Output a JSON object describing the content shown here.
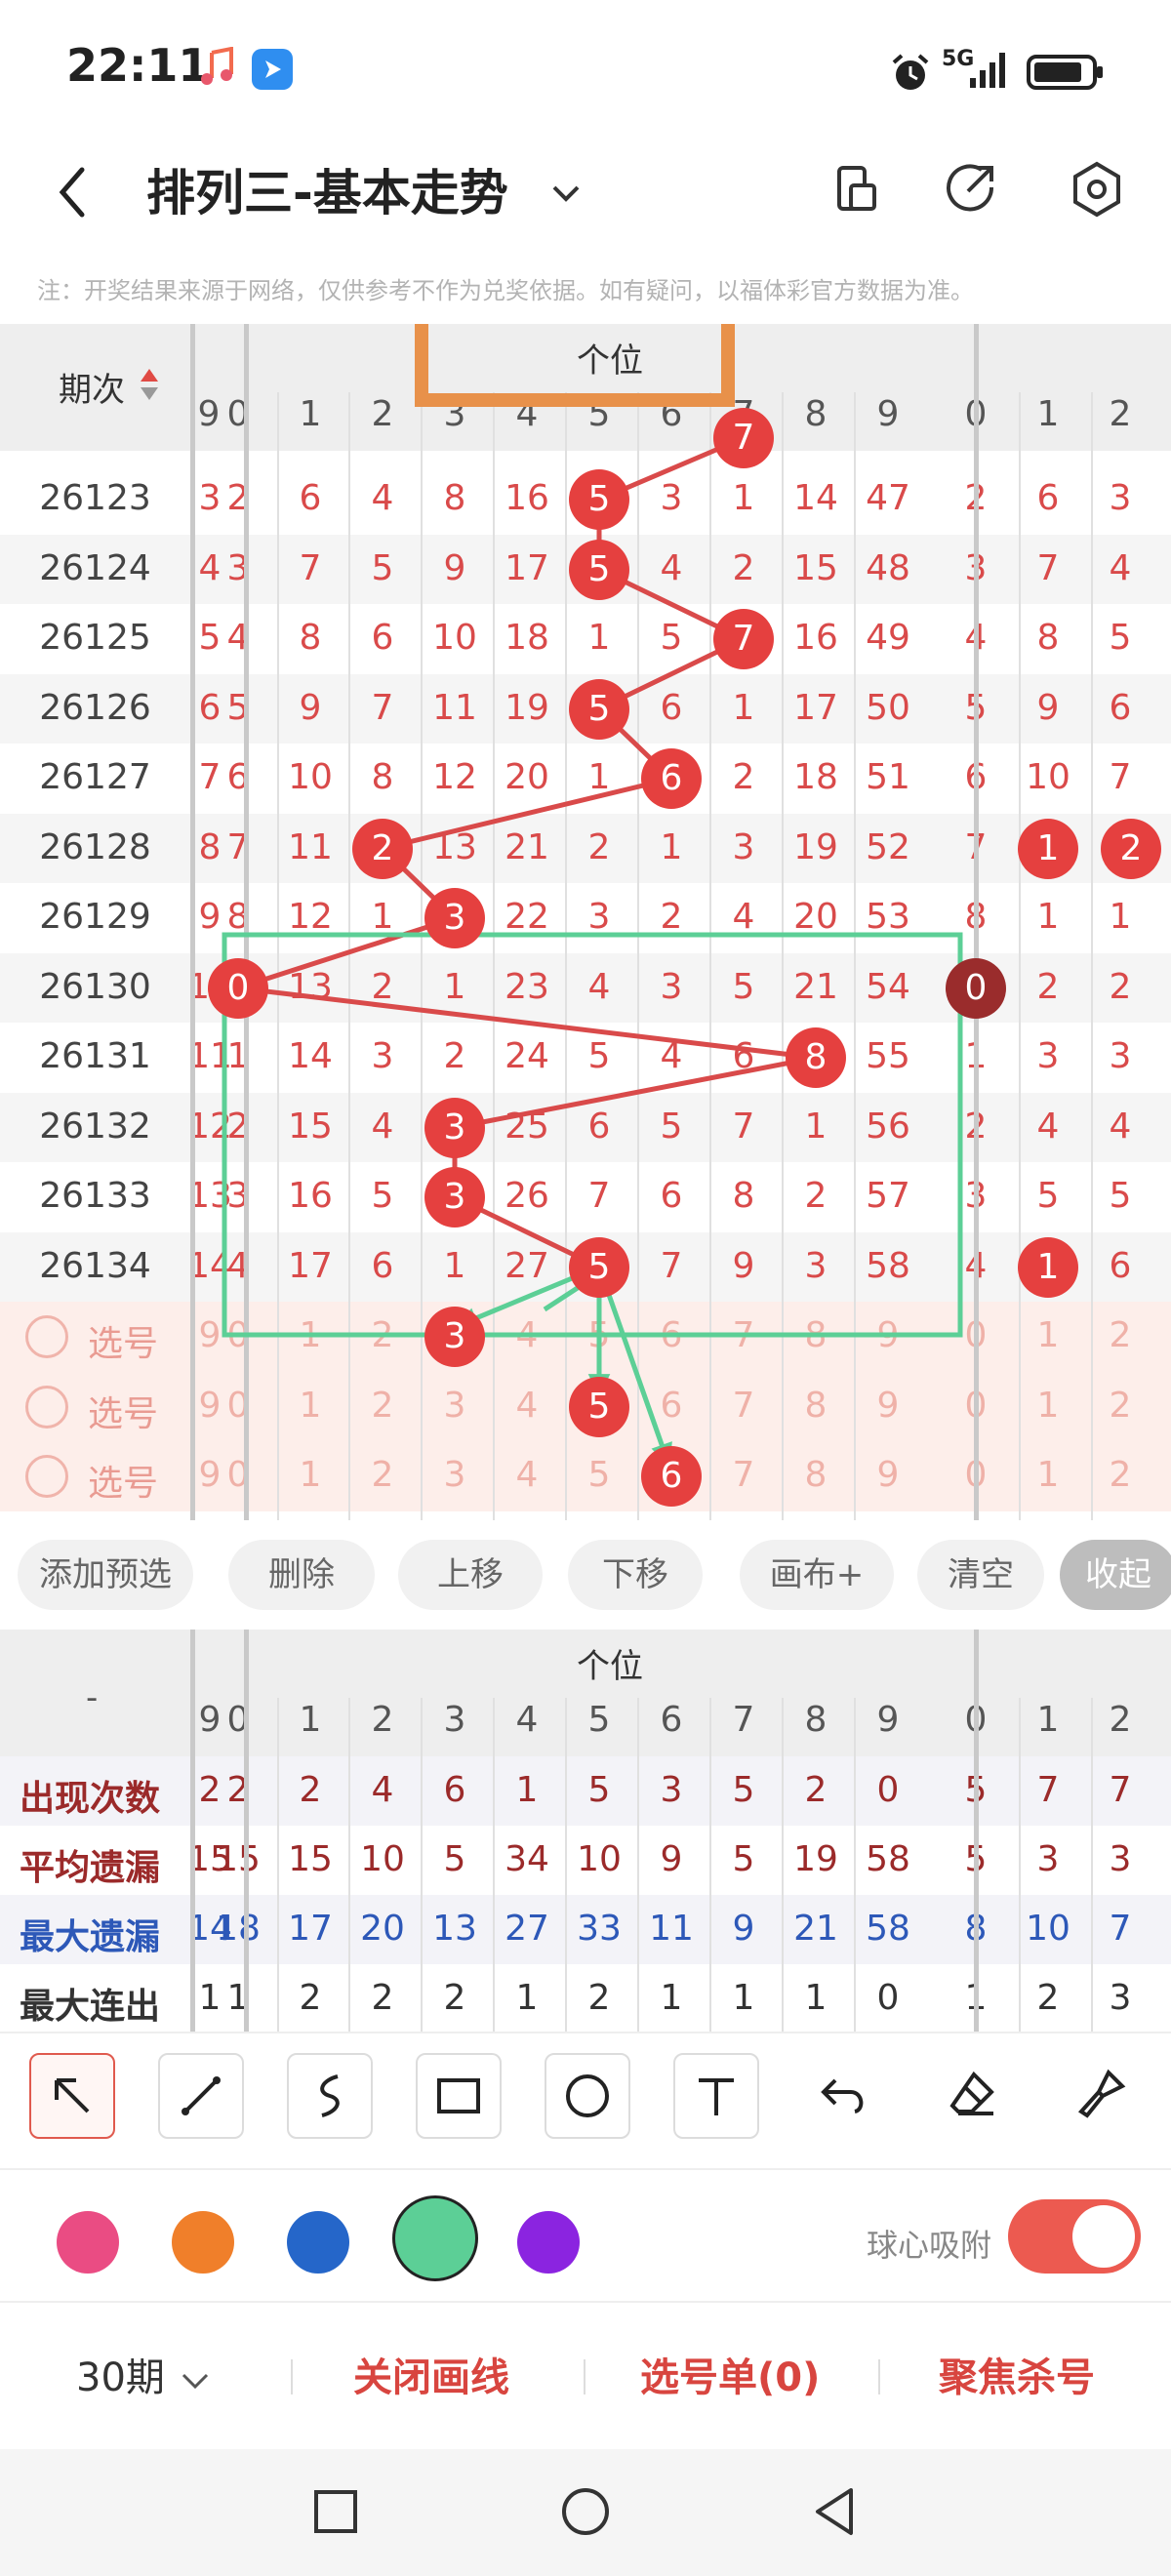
{
  "status": {
    "time": "22:11",
    "network": "5G"
  },
  "header": {
    "title": "排列三-基本走势"
  },
  "notice": "注：开奖结果来源于网络，仅供参考不作为兑奖依据。如有疑问，以福体彩官方数据为准。",
  "trend": {
    "period_header": "期次",
    "group_label": "个位",
    "column_digits": [
      "9",
      "0",
      "1",
      "2",
      "3",
      "4",
      "5",
      "6",
      "7",
      "8",
      "9",
      "0",
      "1",
      "2"
    ],
    "rows": [
      {
        "period": "26123",
        "cells": [
          "3",
          "2",
          "6",
          "4",
          "8",
          "16",
          "5",
          "3",
          "1",
          "14",
          "47",
          "2",
          "6",
          "3"
        ]
      },
      {
        "period": "26124",
        "cells": [
          "4",
          "3",
          "7",
          "5",
          "9",
          "17",
          "5",
          "4",
          "2",
          "15",
          "48",
          "3",
          "7",
          "4"
        ]
      },
      {
        "period": "26125",
        "cells": [
          "5",
          "4",
          "8",
          "6",
          "10",
          "18",
          "1",
          "5",
          "7",
          "16",
          "49",
          "4",
          "8",
          "5"
        ]
      },
      {
        "period": "26126",
        "cells": [
          "6",
          "5",
          "9",
          "7",
          "11",
          "19",
          "5",
          "6",
          "1",
          "17",
          "50",
          "5",
          "9",
          "6"
        ]
      },
      {
        "period": "26127",
        "cells": [
          "7",
          "6",
          "10",
          "8",
          "12",
          "20",
          "1",
          "6",
          "2",
          "18",
          "51",
          "6",
          "10",
          "7"
        ]
      },
      {
        "period": "26128",
        "cells": [
          "8",
          "7",
          "11",
          "2",
          "13",
          "21",
          "2",
          "1",
          "3",
          "19",
          "52",
          "7",
          "1",
          "2"
        ]
      },
      {
        "period": "26129",
        "cells": [
          "9",
          "8",
          "12",
          "1",
          "3",
          "22",
          "3",
          "2",
          "4",
          "20",
          "53",
          "8",
          "1",
          "1"
        ]
      },
      {
        "period": "26130",
        "cells": [
          "10",
          "0",
          "13",
          "2",
          "1",
          "23",
          "4",
          "3",
          "5",
          "21",
          "54",
          "0",
          "2",
          "2"
        ]
      },
      {
        "period": "26131",
        "cells": [
          "11",
          "1",
          "14",
          "3",
          "2",
          "24",
          "5",
          "4",
          "6",
          "8",
          "55",
          "1",
          "3",
          "3"
        ]
      },
      {
        "period": "26132",
        "cells": [
          "12",
          "2",
          "15",
          "4",
          "3",
          "25",
          "6",
          "5",
          "7",
          "1",
          "56",
          "2",
          "4",
          "4"
        ]
      },
      {
        "period": "26133",
        "cells": [
          "13",
          "3",
          "16",
          "5",
          "3",
          "26",
          "7",
          "6",
          "8",
          "2",
          "57",
          "3",
          "5",
          "5"
        ]
      },
      {
        "period": "26134",
        "cells": [
          "14",
          "4",
          "17",
          "6",
          "1",
          "27",
          "5",
          "7",
          "9",
          "3",
          "58",
          "4",
          "1",
          "6"
        ]
      }
    ],
    "pick_rows": [
      {
        "label": "选号",
        "cells": [
          "9",
          "0",
          "1",
          "2",
          "3",
          "4",
          "5",
          "6",
          "7",
          "8",
          "9",
          "0",
          "1",
          "2"
        ]
      },
      {
        "label": "选号",
        "cells": [
          "9",
          "0",
          "1",
          "2",
          "3",
          "4",
          "5",
          "6",
          "7",
          "8",
          "9",
          "0",
          "1",
          "2"
        ]
      },
      {
        "label": "选号",
        "cells": [
          "9",
          "0",
          "1",
          "2",
          "3",
          "4",
          "5",
          "6",
          "7",
          "8",
          "9",
          "0",
          "1",
          "2"
        ]
      }
    ],
    "top_partial_ball": "7"
  },
  "actions": [
    "添加预选",
    "删除",
    "上移",
    "下移",
    "画布+",
    "清空",
    "收起"
  ],
  "stats": {
    "dash": "-",
    "group_label": "个位",
    "column_digits": [
      "9",
      "0",
      "1",
      "2",
      "3",
      "4",
      "5",
      "6",
      "7",
      "8",
      "9",
      "0",
      "1",
      "2"
    ],
    "rows": [
      {
        "label": "出现次数",
        "color": "#9b2a2a",
        "cells": [
          "2",
          "2",
          "2",
          "4",
          "6",
          "1",
          "5",
          "3",
          "5",
          "2",
          "0",
          "5",
          "7",
          "7"
        ]
      },
      {
        "label": "平均遗漏",
        "color": "#9b2a2a",
        "cells": [
          "15",
          "15",
          "15",
          "10",
          "5",
          "34",
          "10",
          "9",
          "5",
          "19",
          "58",
          "5",
          "3",
          "3"
        ]
      },
      {
        "label": "最大遗漏",
        "color": "#2d58b8",
        "cells": [
          "14",
          "18",
          "17",
          "20",
          "13",
          "27",
          "33",
          "11",
          "9",
          "21",
          "58",
          "8",
          "10",
          "7"
        ]
      },
      {
        "label": "最大连出",
        "color": "#333333",
        "cells": [
          "1",
          "1",
          "2",
          "2",
          "2",
          "1",
          "2",
          "1",
          "1",
          "1",
          "0",
          "1",
          "2",
          "3"
        ]
      }
    ]
  },
  "draw_tools": [
    "arrow-tool",
    "line-tool",
    "freehand-tool",
    "rectangle-tool",
    "circle-tool",
    "text-tool",
    "undo-tool",
    "eraser-tool",
    "brush-tool"
  ],
  "palette": {
    "colors": [
      "#ea4c83",
      "#f07f2a",
      "#2566c9",
      "#5ccf96",
      "#8b24e0"
    ],
    "selected_index": 3,
    "snap_label": "球心吸附",
    "snap_on": true
  },
  "bottom": {
    "periods": "30期",
    "close_lines": "关闭画线",
    "selection_list": "选号单(0)",
    "focus_kill": "聚焦杀号"
  }
}
